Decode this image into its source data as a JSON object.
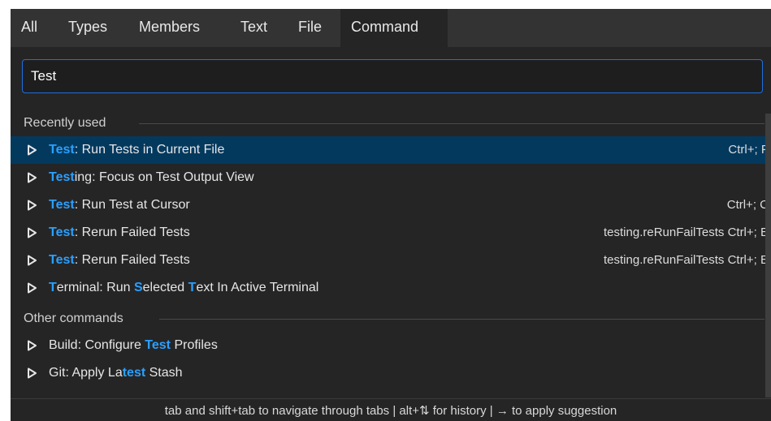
{
  "tabs": [
    {
      "label": "All"
    },
    {
      "label": "Types"
    },
    {
      "label": "Members"
    },
    {
      "label": "Text"
    },
    {
      "label": "File"
    },
    {
      "label": "Command",
      "active": true
    }
  ],
  "search": {
    "value": "Test"
  },
  "sections": {
    "recent": "Recently used",
    "other": "Other commands"
  },
  "recent_items": [
    {
      "parts": [
        [
          "Test",
          true
        ],
        [
          ": Run Tests in Current File",
          false
        ]
      ],
      "keybinding": "Ctrl+; F",
      "selected": true
    },
    {
      "parts": [
        [
          "Test",
          true
        ],
        [
          "ing: Focus on Test Output View",
          false
        ]
      ],
      "keybinding": ""
    },
    {
      "parts": [
        [
          "Test",
          true
        ],
        [
          ": Run Test at Cursor",
          false
        ]
      ],
      "keybinding": "Ctrl+; C"
    },
    {
      "parts": [
        [
          "Test",
          true
        ],
        [
          ": Rerun Failed Tests",
          false
        ]
      ],
      "keybinding": "testing.reRunFailTests Ctrl+; E"
    },
    {
      "parts": [
        [
          "Test",
          true
        ],
        [
          ": Rerun Failed Tests",
          false
        ]
      ],
      "keybinding": "testing.reRunFailTests Ctrl+; E"
    },
    {
      "parts": [
        [
          "T",
          true
        ],
        [
          "erminal: Run ",
          false
        ],
        [
          "S",
          true
        ],
        [
          "elected ",
          false
        ],
        [
          "T",
          true
        ],
        [
          "ext In Active Terminal",
          false
        ]
      ],
      "keybinding": ""
    }
  ],
  "other_items": [
    {
      "parts": [
        [
          "Build: Configure ",
          false
        ],
        [
          "Test",
          true
        ],
        [
          " Profiles",
          false
        ]
      ],
      "keybinding": ""
    },
    {
      "parts": [
        [
          "Git: Apply La",
          false
        ],
        [
          "test",
          true
        ],
        [
          " Stash",
          false
        ]
      ],
      "keybinding": ""
    }
  ],
  "footer": {
    "text": "tab and shift+tab to navigate through tabs  |  alt+⇅ for history  |  → to apply suggestion"
  },
  "colors": {
    "highlight": "#2aa0ff",
    "selection": "#04395e",
    "focus_border": "#1f6fe0",
    "panel_bg": "#252526"
  },
  "icons": {
    "row_expander": "play-triangle-outline-icon"
  }
}
